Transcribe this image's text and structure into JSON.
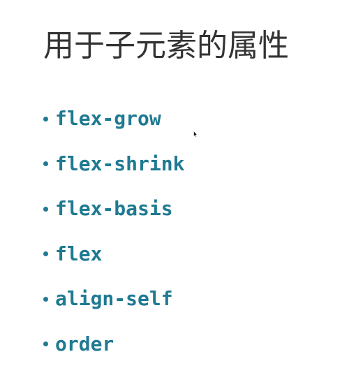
{
  "slide": {
    "title": "用于子元素的属性",
    "items": [
      {
        "label": "flex-grow"
      },
      {
        "label": "flex-shrink"
      },
      {
        "label": "flex-basis"
      },
      {
        "label": "flex"
      },
      {
        "label": "align-self"
      },
      {
        "label": "order"
      }
    ]
  },
  "colors": {
    "title": "#333333",
    "accent": "#1f7a92",
    "background": "#ffffff"
  },
  "icons": {
    "cursor": "mouse-pointer-icon"
  }
}
